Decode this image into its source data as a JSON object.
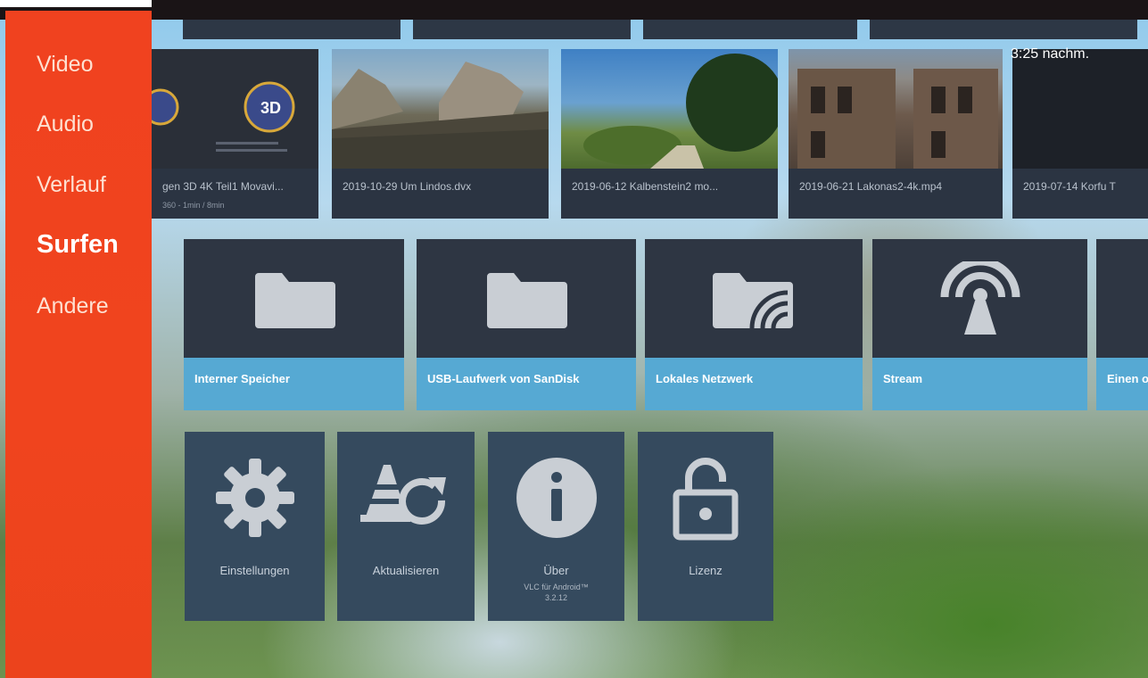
{
  "sidebar": {
    "items": [
      {
        "label": "Video"
      },
      {
        "label": "Audio"
      },
      {
        "label": "Verlauf"
      },
      {
        "label": "Surfen",
        "active": true
      },
      {
        "label": "Andere"
      }
    ]
  },
  "status": {
    "time": "3:25 nachm."
  },
  "recent_videos": [
    {
      "title": "gen 3D 4K Teil1 Movavi...",
      "meta": "360 - 1min / 8min"
    },
    {
      "title": "2019-10-29 Um Lindos.dvx"
    },
    {
      "title": "2019-06-12 Kalbenstein2 mo..."
    },
    {
      "title": "2019-06-21 Lakonas2-4k.mp4"
    },
    {
      "title": "2019-07-14 Korfu T"
    }
  ],
  "storage": [
    {
      "label": "Interner Speicher",
      "icon": "folder-icon"
    },
    {
      "label": "USB-Laufwerk von SanDisk",
      "icon": "folder-icon"
    },
    {
      "label": "Lokales Netzwerk",
      "icon": "network-folder-icon"
    },
    {
      "label": "Stream",
      "icon": "stream-antenna-icon"
    },
    {
      "label": "Einen o"
    }
  ],
  "actions": [
    {
      "label": "Einstellungen",
      "icon": "gear-icon"
    },
    {
      "label": "Aktualisieren",
      "icon": "refresh-cone-icon"
    },
    {
      "label": "Über",
      "sublabel": "VLC für Android™ 3.2.12",
      "icon": "info-icon"
    },
    {
      "label": "Lizenz",
      "icon": "padlock-icon"
    }
  ],
  "colors": {
    "sidebar": "#f0421f",
    "tile_dark": "#2e3643",
    "label_bar": "#56a9d3",
    "action_tile": "#354a5e"
  }
}
